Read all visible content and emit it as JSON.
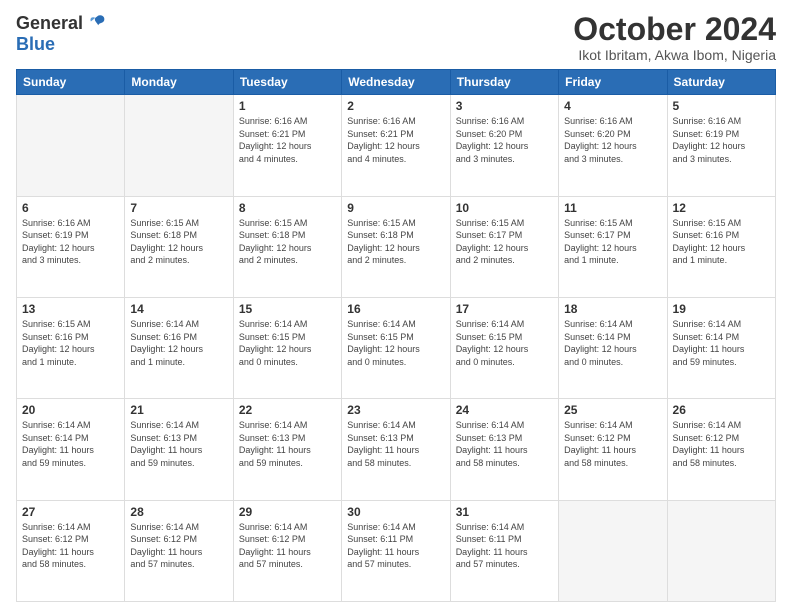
{
  "header": {
    "logo_general": "General",
    "logo_blue": "Blue",
    "month_title": "October 2024",
    "location": "Ikot Ibritam, Akwa Ibom, Nigeria"
  },
  "days_of_week": [
    "Sunday",
    "Monday",
    "Tuesday",
    "Wednesday",
    "Thursday",
    "Friday",
    "Saturday"
  ],
  "weeks": [
    [
      {
        "day": "",
        "info": ""
      },
      {
        "day": "",
        "info": ""
      },
      {
        "day": "1",
        "info": "Sunrise: 6:16 AM\nSunset: 6:21 PM\nDaylight: 12 hours\nand 4 minutes."
      },
      {
        "day": "2",
        "info": "Sunrise: 6:16 AM\nSunset: 6:21 PM\nDaylight: 12 hours\nand 4 minutes."
      },
      {
        "day": "3",
        "info": "Sunrise: 6:16 AM\nSunset: 6:20 PM\nDaylight: 12 hours\nand 3 minutes."
      },
      {
        "day": "4",
        "info": "Sunrise: 6:16 AM\nSunset: 6:20 PM\nDaylight: 12 hours\nand 3 minutes."
      },
      {
        "day": "5",
        "info": "Sunrise: 6:16 AM\nSunset: 6:19 PM\nDaylight: 12 hours\nand 3 minutes."
      }
    ],
    [
      {
        "day": "6",
        "info": "Sunrise: 6:16 AM\nSunset: 6:19 PM\nDaylight: 12 hours\nand 3 minutes."
      },
      {
        "day": "7",
        "info": "Sunrise: 6:15 AM\nSunset: 6:18 PM\nDaylight: 12 hours\nand 2 minutes."
      },
      {
        "day": "8",
        "info": "Sunrise: 6:15 AM\nSunset: 6:18 PM\nDaylight: 12 hours\nand 2 minutes."
      },
      {
        "day": "9",
        "info": "Sunrise: 6:15 AM\nSunset: 6:18 PM\nDaylight: 12 hours\nand 2 minutes."
      },
      {
        "day": "10",
        "info": "Sunrise: 6:15 AM\nSunset: 6:17 PM\nDaylight: 12 hours\nand 2 minutes."
      },
      {
        "day": "11",
        "info": "Sunrise: 6:15 AM\nSunset: 6:17 PM\nDaylight: 12 hours\nand 1 minute."
      },
      {
        "day": "12",
        "info": "Sunrise: 6:15 AM\nSunset: 6:16 PM\nDaylight: 12 hours\nand 1 minute."
      }
    ],
    [
      {
        "day": "13",
        "info": "Sunrise: 6:15 AM\nSunset: 6:16 PM\nDaylight: 12 hours\nand 1 minute."
      },
      {
        "day": "14",
        "info": "Sunrise: 6:14 AM\nSunset: 6:16 PM\nDaylight: 12 hours\nand 1 minute."
      },
      {
        "day": "15",
        "info": "Sunrise: 6:14 AM\nSunset: 6:15 PM\nDaylight: 12 hours\nand 0 minutes."
      },
      {
        "day": "16",
        "info": "Sunrise: 6:14 AM\nSunset: 6:15 PM\nDaylight: 12 hours\nand 0 minutes."
      },
      {
        "day": "17",
        "info": "Sunrise: 6:14 AM\nSunset: 6:15 PM\nDaylight: 12 hours\nand 0 minutes."
      },
      {
        "day": "18",
        "info": "Sunrise: 6:14 AM\nSunset: 6:14 PM\nDaylight: 12 hours\nand 0 minutes."
      },
      {
        "day": "19",
        "info": "Sunrise: 6:14 AM\nSunset: 6:14 PM\nDaylight: 11 hours\nand 59 minutes."
      }
    ],
    [
      {
        "day": "20",
        "info": "Sunrise: 6:14 AM\nSunset: 6:14 PM\nDaylight: 11 hours\nand 59 minutes."
      },
      {
        "day": "21",
        "info": "Sunrise: 6:14 AM\nSunset: 6:13 PM\nDaylight: 11 hours\nand 59 minutes."
      },
      {
        "day": "22",
        "info": "Sunrise: 6:14 AM\nSunset: 6:13 PM\nDaylight: 11 hours\nand 59 minutes."
      },
      {
        "day": "23",
        "info": "Sunrise: 6:14 AM\nSunset: 6:13 PM\nDaylight: 11 hours\nand 58 minutes."
      },
      {
        "day": "24",
        "info": "Sunrise: 6:14 AM\nSunset: 6:13 PM\nDaylight: 11 hours\nand 58 minutes."
      },
      {
        "day": "25",
        "info": "Sunrise: 6:14 AM\nSunset: 6:12 PM\nDaylight: 11 hours\nand 58 minutes."
      },
      {
        "day": "26",
        "info": "Sunrise: 6:14 AM\nSunset: 6:12 PM\nDaylight: 11 hours\nand 58 minutes."
      }
    ],
    [
      {
        "day": "27",
        "info": "Sunrise: 6:14 AM\nSunset: 6:12 PM\nDaylight: 11 hours\nand 58 minutes."
      },
      {
        "day": "28",
        "info": "Sunrise: 6:14 AM\nSunset: 6:12 PM\nDaylight: 11 hours\nand 57 minutes."
      },
      {
        "day": "29",
        "info": "Sunrise: 6:14 AM\nSunset: 6:12 PM\nDaylight: 11 hours\nand 57 minutes."
      },
      {
        "day": "30",
        "info": "Sunrise: 6:14 AM\nSunset: 6:11 PM\nDaylight: 11 hours\nand 57 minutes."
      },
      {
        "day": "31",
        "info": "Sunrise: 6:14 AM\nSunset: 6:11 PM\nDaylight: 11 hours\nand 57 minutes."
      },
      {
        "day": "",
        "info": ""
      },
      {
        "day": "",
        "info": ""
      }
    ]
  ]
}
